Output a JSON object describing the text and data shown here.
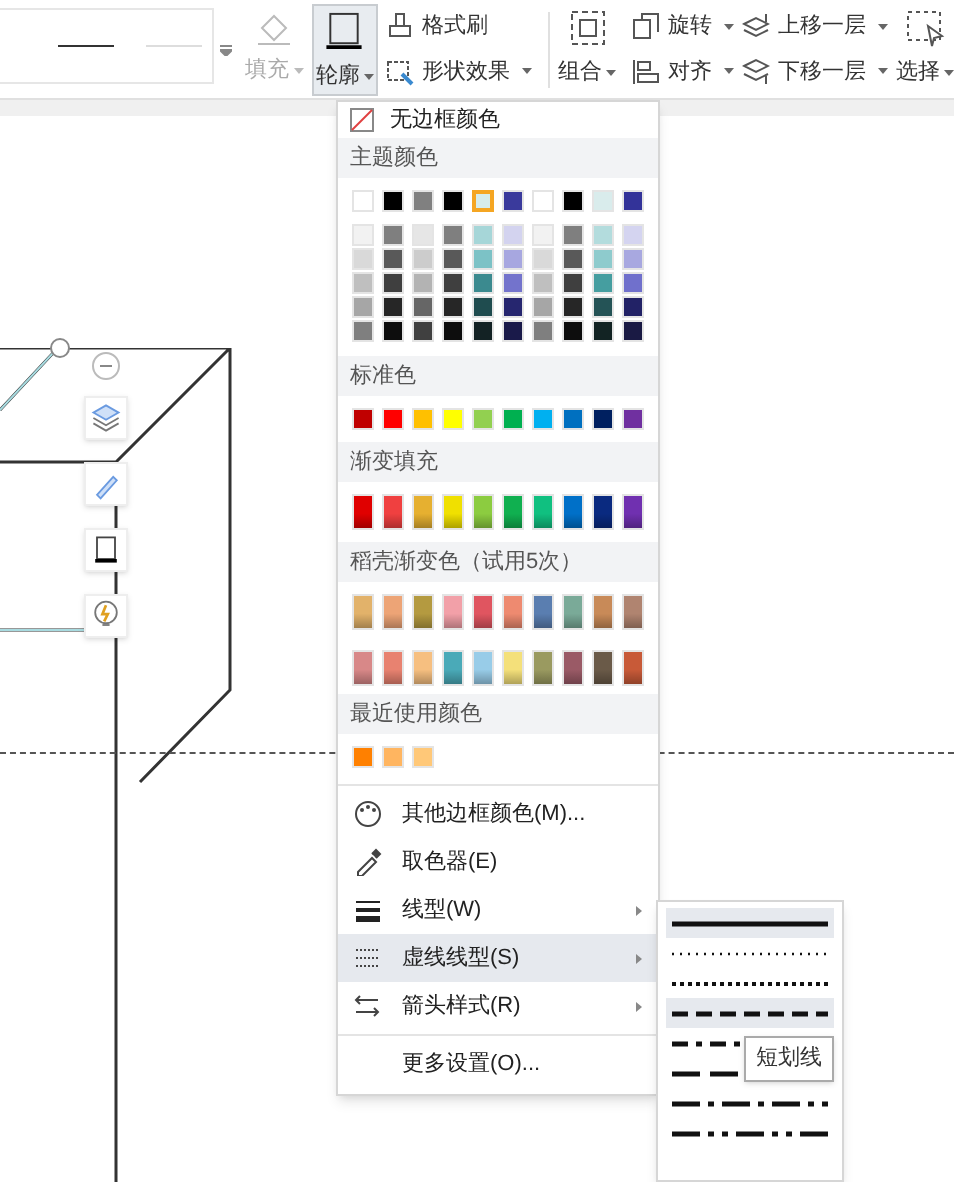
{
  "ribbon": {
    "fill": {
      "label": "填充",
      "disabled": true
    },
    "outline": {
      "label": "轮廓",
      "selected": true
    },
    "tools": [
      {
        "label": "格式刷",
        "kind": "brush",
        "caret": false
      },
      {
        "label": "形状效果",
        "kind": "effect",
        "caret": true
      }
    ],
    "group": {
      "label": "组合"
    },
    "arrange": [
      {
        "label": "旋转",
        "kind": "rotate"
      },
      {
        "label": "对齐",
        "kind": "align"
      }
    ],
    "layers": [
      {
        "label": "上移一层",
        "kind": "up"
      },
      {
        "label": "下移一层",
        "kind": "down"
      }
    ],
    "select": {
      "label": "选择"
    }
  },
  "menu": {
    "no_border": "无边框颜色",
    "theme": {
      "title": "主题颜色",
      "colors": [
        {
          "color": "#ffffff",
          "selected": false
        },
        {
          "color": "#000000",
          "selected": false
        },
        {
          "color": "#808080",
          "selected": false
        },
        {
          "color": "#000000",
          "selected": false
        },
        {
          "color": "#d6ecec",
          "selected": true
        },
        {
          "color": "#3a3a9c",
          "selected": false
        },
        {
          "color": "#ffffff",
          "selected": false
        },
        {
          "color": "#000000",
          "selected": false
        },
        {
          "color": "#d9ecec",
          "selected": false
        },
        {
          "color": "#333399",
          "selected": false
        }
      ],
      "shades": [
        [
          {
            "color": "#f2f2f2"
          },
          {
            "color": "#7f7f7f"
          },
          {
            "color": "#e6e6e6"
          },
          {
            "color": "#7f7f7f"
          },
          {
            "color": "#a6d6d8"
          },
          {
            "color": "#d3d3ef"
          },
          {
            "color": "#f2f2f2"
          },
          {
            "color": "#7f7f7f"
          },
          {
            "color": "#b3dcdd"
          },
          {
            "color": "#d4d4f0"
          }
        ],
        [
          {
            "color": "#d9d9d9"
          },
          {
            "color": "#595959"
          },
          {
            "color": "#cccccc"
          },
          {
            "color": "#595959"
          },
          {
            "color": "#7cc2c6"
          },
          {
            "color": "#a7a7e0"
          },
          {
            "color": "#d9d9d9"
          },
          {
            "color": "#595959"
          },
          {
            "color": "#8ecbcd"
          },
          {
            "color": "#a8a8e0"
          }
        ],
        [
          {
            "color": "#bfbfbf"
          },
          {
            "color": "#3f3f3f"
          },
          {
            "color": "#b3b3b3"
          },
          {
            "color": "#3f3f3f"
          },
          {
            "color": "#3b8a8f"
          },
          {
            "color": "#7373cc"
          },
          {
            "color": "#bfbfbf"
          },
          {
            "color": "#3f3f3f"
          },
          {
            "color": "#459ea0"
          },
          {
            "color": "#7070cc"
          }
        ],
        [
          {
            "color": "#a6a6a6"
          },
          {
            "color": "#262626"
          },
          {
            "color": "#666666"
          },
          {
            "color": "#262626"
          },
          {
            "color": "#1f4c4f"
          },
          {
            "color": "#26266f"
          },
          {
            "color": "#a6a6a6"
          },
          {
            "color": "#262626"
          },
          {
            "color": "#245356"
          },
          {
            "color": "#222266"
          }
        ],
        [
          {
            "color": "#7f7f7f"
          },
          {
            "color": "#0d0d0d"
          },
          {
            "color": "#404040"
          },
          {
            "color": "#0d0d0d"
          },
          {
            "color": "#132224"
          },
          {
            "color": "#1a1a4a"
          },
          {
            "color": "#7f7f7f"
          },
          {
            "color": "#0d0d0d"
          },
          {
            "color": "#122323"
          },
          {
            "color": "#1a1a44"
          }
        ]
      ]
    },
    "standard": {
      "title": "标准色",
      "colors": [
        {
          "color": "#c00000"
        },
        {
          "color": "#ff0000"
        },
        {
          "color": "#ffc000"
        },
        {
          "color": "#ffff00"
        },
        {
          "color": "#92d050"
        },
        {
          "color": "#00b050"
        },
        {
          "color": "#00b0f0"
        },
        {
          "color": "#0070c0"
        },
        {
          "color": "#002060"
        },
        {
          "color": "#7030a0"
        }
      ]
    },
    "gradient": {
      "title": "渐变填充",
      "colors": [
        {
          "color": "#e00000"
        },
        {
          "color": "#f04040"
        },
        {
          "color": "#e6b030"
        },
        {
          "color": "#f0e000"
        },
        {
          "color": "#8ccc40"
        },
        {
          "color": "#10b050"
        },
        {
          "color": "#10c080"
        },
        {
          "color": "#0070c8"
        },
        {
          "color": "#0a2a80"
        },
        {
          "color": "#7030b0"
        }
      ]
    },
    "straw": {
      "title": "稻壳渐变色（试用5次）",
      "rows": [
        [
          {
            "color": "#e2b26a"
          },
          {
            "color": "#eda476"
          },
          {
            "color": "#b49a40"
          },
          {
            "color": "#f2a0a8"
          },
          {
            "color": "#e05560"
          },
          {
            "color": "#ee8a70"
          },
          {
            "color": "#5a7eb0"
          },
          {
            "color": "#7aaa98"
          },
          {
            "color": "#c88a58"
          },
          {
            "color": "#b08470"
          }
        ],
        [
          {
            "color": "#d88888"
          },
          {
            "color": "#e88270"
          },
          {
            "color": "#f6bf80"
          },
          {
            "color": "#4aaab8"
          },
          {
            "color": "#98cce8"
          },
          {
            "color": "#f4e07a"
          },
          {
            "color": "#9a9a60"
          },
          {
            "color": "#9a5a66"
          },
          {
            "color": "#6a5a48"
          },
          {
            "color": "#c85a38"
          }
        ]
      ]
    },
    "recent": {
      "title": "最近使用颜色",
      "colors": [
        {
          "color": "#ff8000"
        },
        {
          "color": "#ffb560"
        },
        {
          "color": "#ffc878"
        }
      ]
    },
    "items": [
      {
        "label": "其他边框颜色(M)...",
        "kind": "palette",
        "submenu": false,
        "selected": false
      },
      {
        "label": "取色器(E)",
        "kind": "picker",
        "submenu": false,
        "selected": false
      },
      {
        "label": "线型(W)",
        "kind": "weight",
        "submenu": true,
        "selected": false
      },
      {
        "label": "虚线线型(S)",
        "kind": "dash",
        "submenu": true,
        "selected": true
      },
      {
        "label": "箭头样式(R)",
        "kind": "arrows",
        "submenu": true,
        "selected": false
      }
    ],
    "more": "更多设置(O)..."
  },
  "dash_menu": {
    "items": [
      {
        "kind": "solid",
        "selected": true
      },
      {
        "kind": "round-dot",
        "selected": false
      },
      {
        "kind": "square-dot",
        "selected": false
      },
      {
        "kind": "dash",
        "selected": true
      },
      {
        "kind": "dash-dot",
        "selected": false
      },
      {
        "kind": "long-dash",
        "selected": false
      },
      {
        "kind": "long-dash-dot",
        "selected": false
      },
      {
        "kind": "long-dash-dot-dot",
        "selected": false
      }
    ],
    "tooltip": "短划线"
  }
}
